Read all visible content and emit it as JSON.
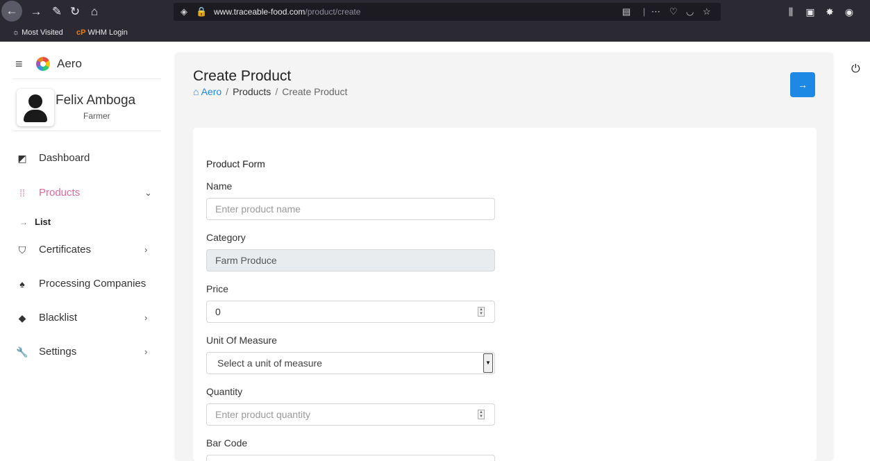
{
  "browser": {
    "url_host": "www.traceable-food.com",
    "url_path": "/product/create",
    "bookmarks": [
      {
        "label": "Most Visited",
        "icon": "gear-icon"
      },
      {
        "label": "WHM Login",
        "icon": "cpanel-icon"
      }
    ]
  },
  "sidebar": {
    "brand": "Aero",
    "user_name": "Felix Amboga",
    "user_role": "Farmer",
    "items": [
      {
        "label": "Dashboard",
        "icon": "dashboard-icon"
      },
      {
        "label": "Products",
        "icon": "grid-icon"
      },
      {
        "label": "Certificates",
        "icon": "certificate-icon"
      },
      {
        "label": "Processing Companies",
        "icon": "company-icon"
      },
      {
        "label": "Blacklist",
        "icon": "blacklist-icon"
      },
      {
        "label": "Settings",
        "icon": "wrench-icon"
      }
    ],
    "sub_items": [
      {
        "label": "List"
      }
    ]
  },
  "page": {
    "title": "Create Product",
    "breadcrumb": [
      "Aero",
      "Products",
      "Create Product"
    ]
  },
  "form": {
    "title": "Product Form",
    "name_label": "Name",
    "name_placeholder": "Enter product name",
    "category_label": "Category",
    "category_value": "Farm Produce",
    "price_label": "Price",
    "price_value": "0",
    "unit_label": "Unit Of Measure",
    "unit_selected": "Select a unit of measure",
    "quantity_label": "Quantity",
    "quantity_placeholder": "Enter product quantity",
    "barcode_label": "Bar Code"
  },
  "colors": {
    "accent": "#1e88e5",
    "active_menu": "#e4679b"
  }
}
